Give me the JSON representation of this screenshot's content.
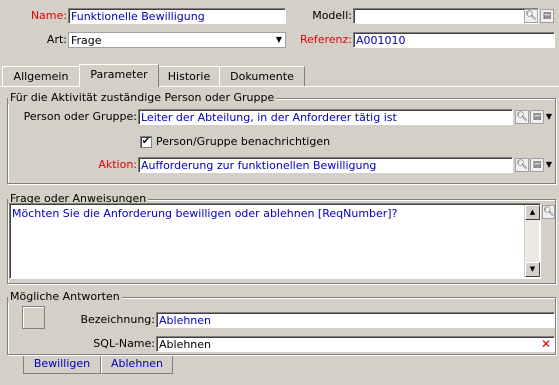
{
  "header": {
    "name_label": "Name:",
    "name_value": "Funktionelle Bewilligung",
    "modell_label": "Modell:",
    "modell_value": "",
    "art_label": "Art:",
    "art_value": "Frage",
    "referenz_label": "Referenz:",
    "referenz_value": "A001010"
  },
  "tabs": [
    {
      "label": "Allgemein",
      "active": false
    },
    {
      "label": "Parameter",
      "active": true
    },
    {
      "label": "Historie",
      "active": false
    },
    {
      "label": "Dokumente",
      "active": false
    }
  ],
  "responsible": {
    "group_title": "Für die Aktivität zuständige Person oder Gruppe",
    "person_label": "Person oder Gruppe:",
    "person_value": "Leiter der Abteilung, in der Anforderer tätig ist",
    "notify_label": "Person/Gruppe benachrichtigen",
    "notify_checked": true,
    "action_label": "Aktion:",
    "action_value": "Aufforderung zur funktionellen Bewilligung"
  },
  "question": {
    "group_title": "Frage oder Anweisungen",
    "text": "Möchten Sie die Anforderung bewilligen oder ablehnen [ReqNumber]?"
  },
  "answers": {
    "group_title": "Mögliche Antworten",
    "bezeichnung_label": "Bezeichnung:",
    "bezeichnung_value": "Ablehnen",
    "sqlname_label": "SQL-Name:",
    "sqlname_value": "Ablehnen",
    "tabs": [
      {
        "label": "Bewilligen",
        "active": false
      },
      {
        "label": "Ablehnen",
        "active": true
      }
    ]
  },
  "icons": {
    "search": "search-icon",
    "detail": "detail-icon",
    "dropdown": "chevron-down-icon",
    "clear": "clear-x-icon"
  },
  "colors": {
    "required_label": "#e00000",
    "link_value": "#0000c0",
    "window_bg": "#d4d0c8"
  }
}
